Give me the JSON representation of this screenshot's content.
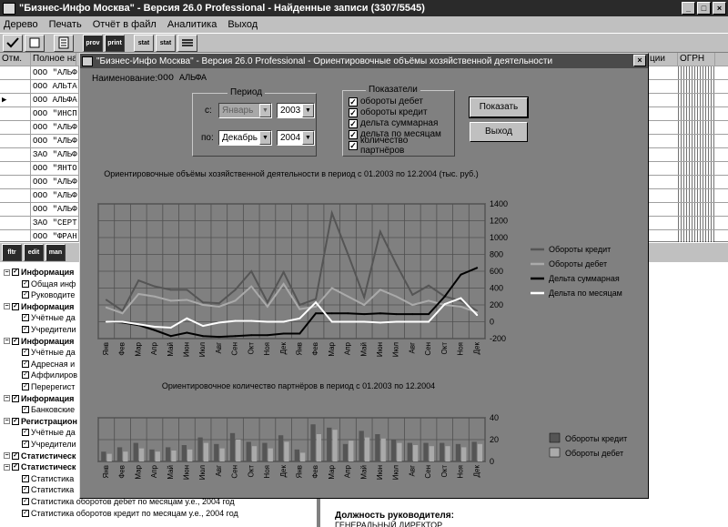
{
  "app": {
    "title": "\"Бизнес-Инфо Москва\" - Версия 26.0 Professional - Найденные записи (3307/5545)",
    "min": "_",
    "max": "□",
    "close": "×"
  },
  "menu": [
    "Дерево",
    "Печать",
    "Отчёт в файл",
    "Аналитика",
    "Выход"
  ],
  "toolbar": [
    "",
    "",
    "",
    "prov",
    "print",
    "stat",
    "stat",
    ""
  ],
  "grid": {
    "headers": [
      "Отм.",
      "Полное наим",
      "ции",
      "ОГРН"
    ],
    "rows": [
      "ООО \"АЛЬФ",
      "ООО АЛЬТА",
      "ООО АЛЬФА",
      "ООО \"ИНСП",
      "ООО \"АЛЬФ",
      "ООО \"АЛЬФ",
      "ЗАО \"АЛЬФ",
      "ООО \"ЯНТО",
      "ООО \"АЛЬФ",
      "ООО \"АЛЬФ",
      "ООО \"АЛЬФ",
      "ЗАО \"СЕРТ",
      "ООО \"ФРАН"
    ]
  },
  "panel_buttons": [
    "fltr",
    "edit",
    "man"
  ],
  "tree": [
    {
      "l": 0,
      "t": "Информация",
      "b": true
    },
    {
      "l": 1,
      "t": "Общая инф"
    },
    {
      "l": 1,
      "t": "Руководите"
    },
    {
      "l": 0,
      "t": "Информация",
      "b": true
    },
    {
      "l": 1,
      "t": "Учётные да"
    },
    {
      "l": 1,
      "t": "Учредители"
    },
    {
      "l": 0,
      "t": "Информация",
      "b": true
    },
    {
      "l": 1,
      "t": "Учётные да"
    },
    {
      "l": 1,
      "t": "Адресная и"
    },
    {
      "l": 1,
      "t": "Аффилиров"
    },
    {
      "l": 1,
      "t": "Перерегист"
    },
    {
      "l": 0,
      "t": "Информация",
      "b": true
    },
    {
      "l": 1,
      "t": "Банковские"
    },
    {
      "l": 0,
      "t": "Регистрацион",
      "b": true
    },
    {
      "l": 1,
      "t": "Учётные да"
    },
    {
      "l": 1,
      "t": "Учредители"
    },
    {
      "l": 0,
      "t": "Статистическ",
      "b": true
    },
    {
      "l": 0,
      "t": "Статистическ",
      "b": true
    },
    {
      "l": 1,
      "t": "Статистика"
    },
    {
      "l": 1,
      "t": "Статистика"
    },
    {
      "l": 1,
      "t": "Статистика оборотов дебет по месяцам у.е., 2004 год"
    },
    {
      "l": 1,
      "t": "Статистика оборотов кредит по месяцам у.е., 2004 год"
    }
  ],
  "right_panel": {
    "role_label": "Должность руководителя:",
    "role_value": "ГЕНЕРАЛЬНЫЙ ДИРЕКТОР"
  },
  "dialog": {
    "title": "\"Бизнес-Инфо Москва\" - Версия 26.0 Professional - Ориентировочные объёмы хозяйственной деятельности",
    "name_label": "Наименование:",
    "name_value": "ООО АЛЬФА",
    "period_label": "Период",
    "from_label": "с:",
    "to_label": "по:",
    "from_month": "Январь",
    "from_year": "2003",
    "to_month": "Декабрь",
    "to_year": "2004",
    "indicators_label": "Показатели",
    "indicators": [
      "обороты дебет",
      "обороты кредит",
      "дельта суммарная",
      "дельта по месяцам",
      "количество партнёров"
    ],
    "show_button": "Показать",
    "exit_button": "Выход"
  },
  "chart_data": [
    {
      "type": "line",
      "title": "Ориентировочные объёмы хозяйственной деятельности в период с 01.2003 по 12.2004 (тыс. руб.)",
      "categories": [
        "Янв",
        "Фев",
        "Мар",
        "Апр",
        "Май",
        "Июн",
        "Июл",
        "Авг",
        "Сен",
        "Окт",
        "Ноя",
        "Дек",
        "Янв",
        "Фев",
        "Мар",
        "Апр",
        "Май",
        "Июн",
        "Июл",
        "Авг",
        "Сен",
        "Окт",
        "Ноя",
        "Дек"
      ],
      "ylim": [
        -200,
        1400
      ],
      "yticks": [
        -200,
        0,
        200,
        400,
        600,
        800,
        1000,
        1200,
        1400
      ],
      "series": [
        {
          "name": "Обороты кредит",
          "color": "#555555",
          "values": [
            260,
            130,
            490,
            420,
            380,
            380,
            230,
            220,
            380,
            600,
            230,
            590,
            200,
            270,
            1290,
            800,
            290,
            1070,
            680,
            320,
            430,
            300,
            250,
            130
          ]
        },
        {
          "name": "Обороты дебет",
          "color": "#aaaaaa",
          "values": [
            170,
            100,
            330,
            300,
            250,
            260,
            200,
            180,
            250,
            420,
            180,
            450,
            150,
            180,
            400,
            300,
            200,
            380,
            300,
            200,
            250,
            200,
            180,
            110
          ]
        },
        {
          "name": "Дельта суммарная",
          "color": "#000000",
          "values": [
            0,
            -10,
            -40,
            -100,
            -170,
            -130,
            -170,
            -180,
            -170,
            -160,
            -160,
            -140,
            -140,
            100,
            100,
            100,
            90,
            100,
            90,
            90,
            90,
            300,
            560,
            640
          ]
        },
        {
          "name": "Дельта по месяцам",
          "color": "#ffffff",
          "values": [
            0,
            0,
            -30,
            -60,
            -70,
            40,
            -50,
            -10,
            10,
            10,
            0,
            0,
            40,
            230,
            0,
            0,
            0,
            -10,
            0,
            0,
            0,
            210,
            280,
            80
          ]
        }
      ]
    },
    {
      "type": "bar",
      "title": "Ориентировочное количество партнёров в период с 01.2003 по 12.2004",
      "categories": [
        "Янв",
        "Фев",
        "Мар",
        "Апр",
        "Май",
        "Июн",
        "Июл",
        "Авг",
        "Сен",
        "Окт",
        "Ноя",
        "Дек",
        "Янв",
        "Фев",
        "Мар",
        "Апр",
        "Май",
        "Июн",
        "Июл",
        "Авг",
        "Сен",
        "Окт",
        "Ноя",
        "Дек"
      ],
      "ylim": [
        0,
        40
      ],
      "yticks": [
        0,
        20,
        40
      ],
      "series": [
        {
          "name": "Обороты кредит",
          "color": "#555555",
          "values": [
            9,
            13,
            17,
            11,
            13,
            15,
            22,
            16,
            26,
            18,
            17,
            24,
            11,
            34,
            31,
            16,
            28,
            25,
            20,
            17,
            17,
            17,
            16,
            18
          ]
        },
        {
          "name": "Обороты дебет",
          "color": "#aaaaaa",
          "values": [
            7,
            9,
            12,
            9,
            10,
            11,
            17,
            12,
            20,
            14,
            12,
            18,
            8,
            25,
            29,
            19,
            22,
            21,
            17,
            15,
            14,
            14,
            13,
            16
          ]
        }
      ]
    }
  ]
}
